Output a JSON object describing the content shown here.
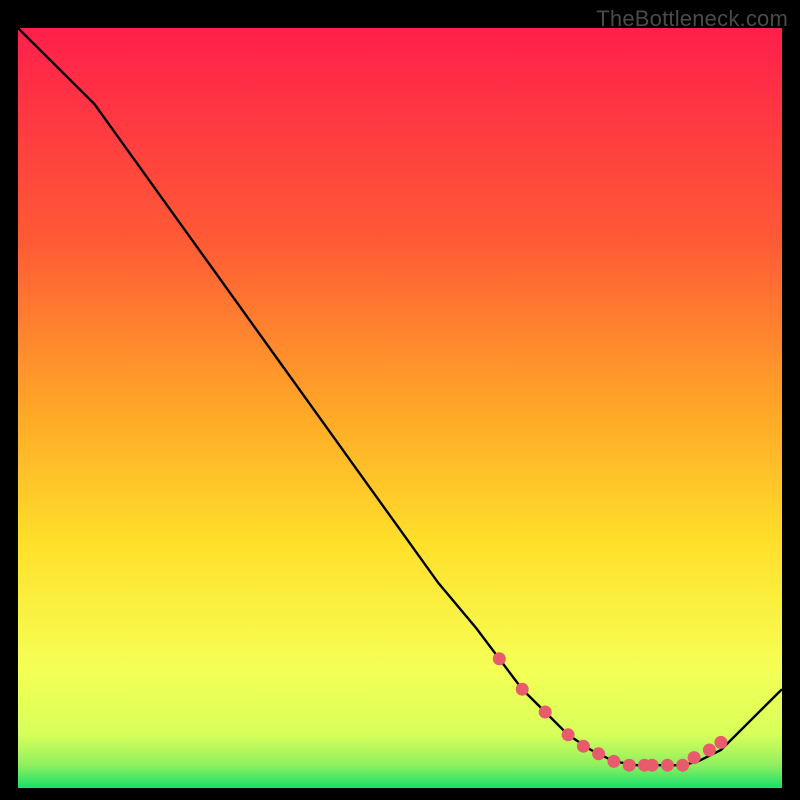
{
  "watermark": "TheBottleneck.com",
  "colors": {
    "bg": "#000000",
    "gradient_top": "#ff1f4b",
    "gradient_mid1": "#ff7a2a",
    "gradient_mid2": "#ffe02a",
    "gradient_mid3": "#f6ff55",
    "gradient_bottom": "#16e06a",
    "line": "#000000",
    "marker": "#e85b6c"
  },
  "chart_data": {
    "type": "line",
    "title": "",
    "xlabel": "",
    "ylabel": "",
    "xlim": [
      0,
      100
    ],
    "ylim": [
      0,
      100
    ],
    "series": [
      {
        "name": "curve",
        "x": [
          0,
          5,
          10,
          15,
          20,
          25,
          30,
          35,
          40,
          45,
          50,
          55,
          60,
          63,
          66,
          69,
          72,
          75,
          78,
          81,
          83,
          85,
          87,
          89,
          92,
          95,
          98,
          100
        ],
        "y": [
          100,
          95,
          90,
          83,
          76,
          69,
          62,
          55,
          48,
          41,
          34,
          27,
          21,
          17,
          13,
          10,
          7,
          5,
          3.5,
          3,
          3,
          3,
          3,
          3.5,
          5,
          8,
          11,
          13
        ]
      }
    ],
    "markers": {
      "name": "highlight-points",
      "x": [
        63,
        66,
        69,
        72,
        74,
        76,
        78,
        80,
        82,
        83,
        85,
        87,
        88.5,
        90.5,
        92
      ],
      "y": [
        17,
        13,
        10,
        7,
        5.5,
        4.5,
        3.5,
        3,
        3,
        3,
        3,
        3,
        4,
        5,
        6
      ]
    }
  }
}
